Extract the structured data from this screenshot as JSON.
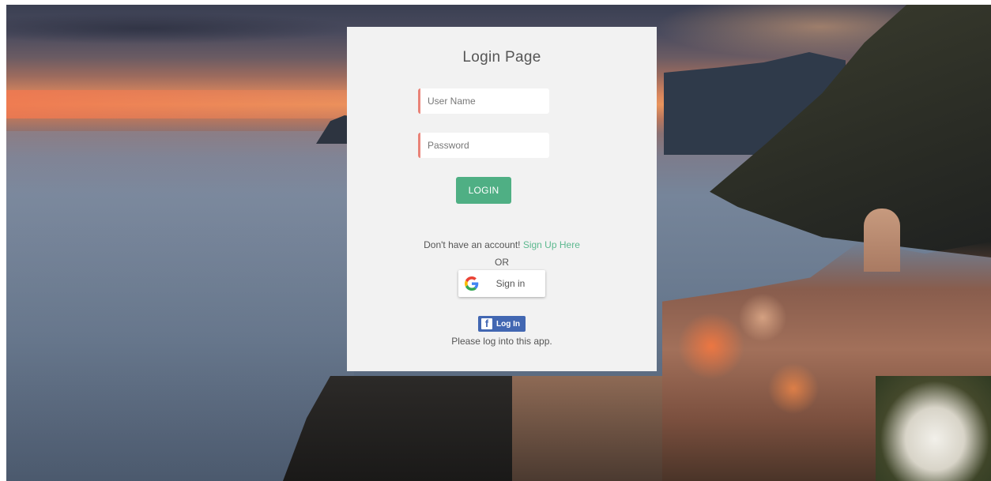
{
  "login": {
    "title": "Login Page",
    "username_placeholder": "User Name",
    "password_placeholder": "Password",
    "login_button": "LOGIN"
  },
  "signup": {
    "prompt": "Don't have an account!",
    "link": "Sign Up Here"
  },
  "or_text": "OR",
  "google": {
    "label": "Sign in",
    "icon": "google-icon"
  },
  "facebook": {
    "glyph": "f",
    "label": "Log In",
    "note": "Please log into this app.",
    "icon": "facebook-icon"
  },
  "colors": {
    "card_background": "#f2f2f2",
    "field_accent": "#e98378",
    "login_button": "#4faf84",
    "link": "#5cb88f",
    "facebook_blue": "#4267b2"
  }
}
